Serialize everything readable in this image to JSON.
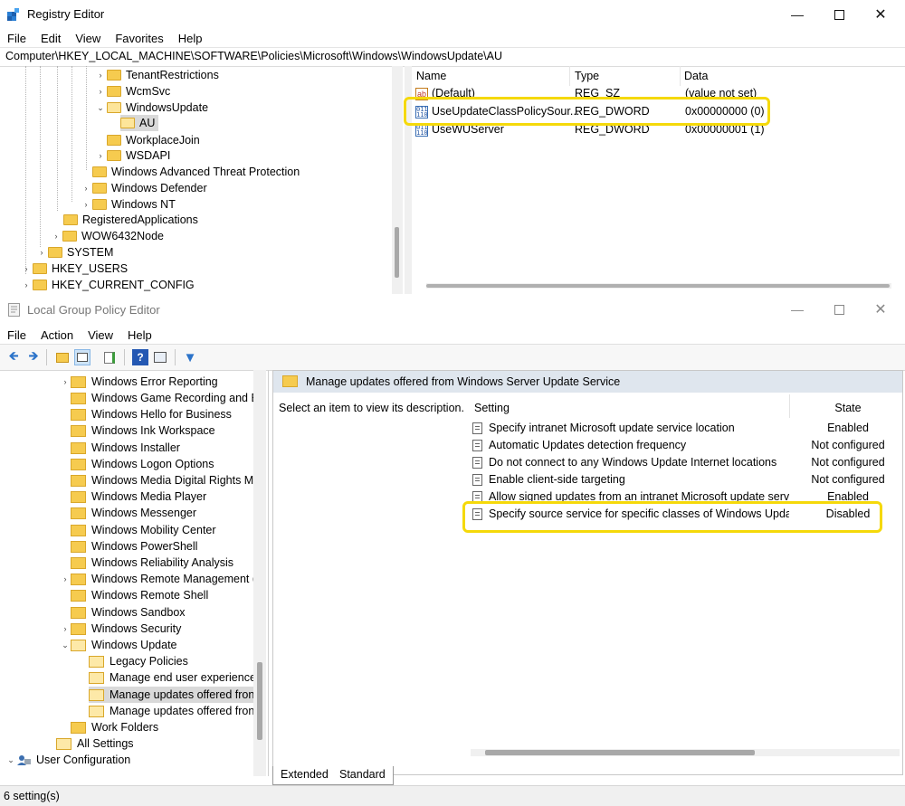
{
  "registry": {
    "title": "Registry Editor",
    "menu": [
      "File",
      "Edit",
      "View",
      "Favorites",
      "Help"
    ],
    "address": "Computer\\HKEY_LOCAL_MACHINE\\SOFTWARE\\Policies\\Microsoft\\Windows\\WindowsUpdate\\AU",
    "tree": [
      {
        "label": "TenantRestrictions",
        "expander": ">"
      },
      {
        "label": "WcmSvc",
        "expander": ">"
      },
      {
        "label": "WindowsUpdate",
        "expander": "v"
      },
      {
        "label": "AU",
        "expander": ""
      },
      {
        "label": "WorkplaceJoin",
        "expander": ""
      },
      {
        "label": "WSDAPI",
        "expander": ">"
      },
      {
        "label": "Windows Advanced Threat Protection",
        "expander": ""
      },
      {
        "label": "Windows Defender",
        "expander": ">"
      },
      {
        "label": "Windows NT",
        "expander": ">"
      },
      {
        "label": "RegisteredApplications",
        "expander": ""
      },
      {
        "label": "WOW6432Node",
        "expander": ">"
      },
      {
        "label": "SYSTEM",
        "expander": ">"
      },
      {
        "label": "HKEY_USERS",
        "expander": ">"
      },
      {
        "label": "HKEY_CURRENT_CONFIG",
        "expander": ">"
      }
    ],
    "columns": {
      "name": "Name",
      "type": "Type",
      "data": "Data"
    },
    "values": [
      {
        "name": "(Default)",
        "type": "REG_SZ",
        "data": "(value not set)",
        "icon": "ab"
      },
      {
        "name": "UseUpdateClassPolicySour...",
        "type": "REG_DWORD",
        "data": "0x00000000 (0)",
        "icon": "dword"
      },
      {
        "name": "UseWUServer",
        "type": "REG_DWORD",
        "data": "0x00000001 (1)",
        "icon": "dword"
      }
    ]
  },
  "gpe": {
    "title": "Local Group Policy Editor",
    "menu": [
      "File",
      "Action",
      "View",
      "Help"
    ],
    "tree": [
      {
        "label": "Windows Error Reporting",
        "expander": ">"
      },
      {
        "label": "Windows Game Recording and Br",
        "expander": ""
      },
      {
        "label": "Windows Hello for Business",
        "expander": ""
      },
      {
        "label": "Windows Ink Workspace",
        "expander": ""
      },
      {
        "label": "Windows Installer",
        "expander": ""
      },
      {
        "label": "Windows Logon Options",
        "expander": ""
      },
      {
        "label": "Windows Media Digital Rights M",
        "expander": ""
      },
      {
        "label": "Windows Media Player",
        "expander": ""
      },
      {
        "label": "Windows Messenger",
        "expander": ""
      },
      {
        "label": "Windows Mobility Center",
        "expander": ""
      },
      {
        "label": "Windows PowerShell",
        "expander": ""
      },
      {
        "label": "Windows Reliability Analysis",
        "expander": ""
      },
      {
        "label": "Windows Remote Management (\\",
        "expander": ">"
      },
      {
        "label": "Windows Remote Shell",
        "expander": ""
      },
      {
        "label": "Windows Sandbox",
        "expander": ""
      },
      {
        "label": "Windows Security",
        "expander": ">"
      },
      {
        "label": "Windows Update",
        "expander": "v"
      },
      {
        "label": "Legacy Policies",
        "expander": ""
      },
      {
        "label": "Manage end user experience",
        "expander": ""
      },
      {
        "label": "Manage updates offered fron",
        "expander": ""
      },
      {
        "label": "Manage updates offered fron",
        "expander": ""
      },
      {
        "label": "Work Folders",
        "expander": ""
      },
      {
        "label": "All Settings",
        "expander": ""
      },
      {
        "label": "User Configuration",
        "expander": "v"
      }
    ],
    "folder_title": "Manage updates offered from Windows Server Update Service",
    "description": "Select an item to view its description.",
    "col_setting": "Setting",
    "col_state": "State",
    "policies": [
      {
        "name": "Specify intranet Microsoft update service location",
        "state": "Enabled"
      },
      {
        "name": "Automatic Updates detection frequency",
        "state": "Not configured"
      },
      {
        "name": "Do not connect to any Windows Update Internet locations",
        "state": "Not configured"
      },
      {
        "name": "Enable client-side targeting",
        "state": "Not configured"
      },
      {
        "name": "Allow signed updates from an intranet Microsoft update service location",
        "state": "Enabled"
      },
      {
        "name": "Specify source service for specific classes of Windows Updates",
        "state": "Disabled"
      }
    ],
    "tabs": [
      "Extended",
      "Standard"
    ],
    "status": "6 setting(s)"
  }
}
